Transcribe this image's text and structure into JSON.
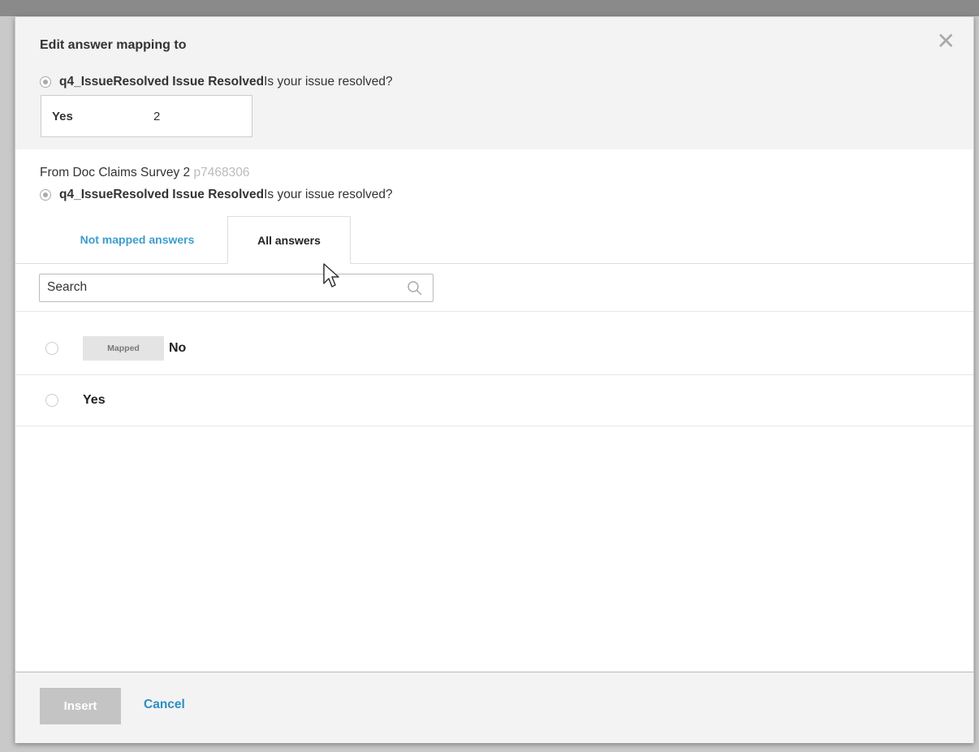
{
  "dialog": {
    "title": "Edit answer mapping to",
    "close_glyph": "✕"
  },
  "target": {
    "question_id": "q4_IssueResolved",
    "question_label": "Issue Resolved",
    "question_text": "Is your issue resolved?",
    "mapped_answer": "Yes",
    "mapped_count": "2"
  },
  "source": {
    "from_prefix": "From Doc Claims Survey 2",
    "project_id": "p7468306",
    "question_id": "q4_IssueResolved",
    "question_label": "Issue Resolved",
    "question_text": "Is your issue resolved?"
  },
  "tabs": {
    "not_mapped": "Not mapped answers",
    "all": "All answers",
    "active": "all"
  },
  "search": {
    "placeholder": "Search",
    "icon": "search-icon"
  },
  "answers": [
    {
      "badge": "Mapped",
      "label": "No",
      "selected": false
    },
    {
      "badge": "",
      "label": "Yes",
      "selected": false
    }
  ],
  "footer": {
    "insert_label": "Insert",
    "cancel_label": "Cancel"
  },
  "colors": {
    "accent_blue": "#2a8fc4",
    "tab_blue": "#3c9dd0",
    "disabled_button": "#c4c4c4",
    "section_bg": "#f3f3f3"
  }
}
